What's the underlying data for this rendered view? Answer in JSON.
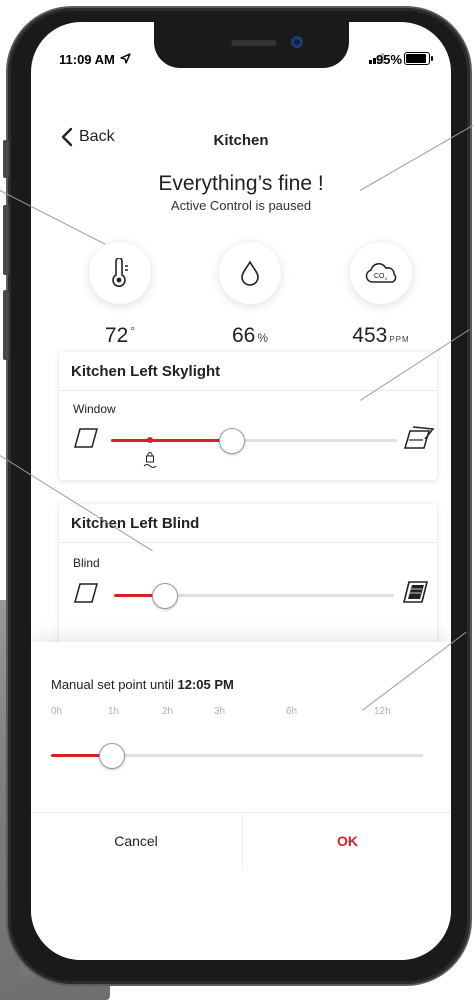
{
  "status_bar": {
    "time": "11:09 AM",
    "battery": "95%"
  },
  "nav": {
    "back_label": "Back",
    "title": "Kitchen"
  },
  "status": {
    "headline": "Everything’s fine !",
    "subline": "Active Control is paused"
  },
  "sensors": [
    {
      "icon": "thermometer-icon",
      "value": "72",
      "unit": "°"
    },
    {
      "icon": "humidity-drop-icon",
      "value": "66",
      "unit": "%"
    },
    {
      "icon": "co2-cloud-icon",
      "value": "453",
      "unit": "PPM"
    }
  ],
  "skylight_card": {
    "title": "Kitchen Left Skylight",
    "label": "Window",
    "position": 0.42
  },
  "blind_card": {
    "title": "Kitchen Left Blind",
    "label": "Blind",
    "position": 0.18
  },
  "manual_sheet": {
    "prefix": "Manual set point until ",
    "time": "12:05 PM",
    "scale": [
      "0h",
      "1h",
      "2h",
      "3h",
      "6h",
      "12h"
    ],
    "position": "1h",
    "cancel_label": "Cancel",
    "ok_label": "OK"
  },
  "colors": {
    "accent": "#d9202a",
    "track": "#e0e0e0"
  }
}
